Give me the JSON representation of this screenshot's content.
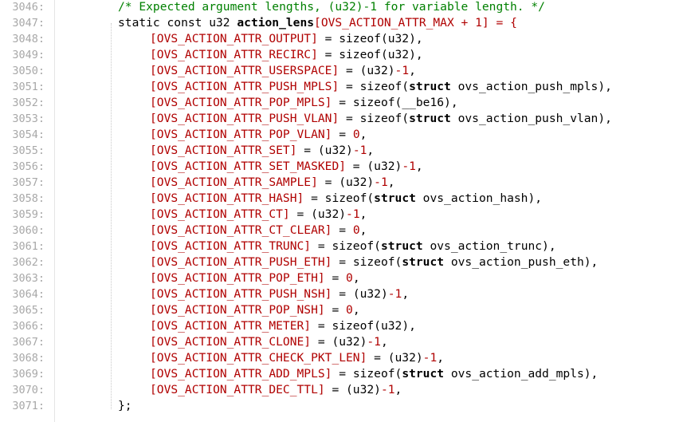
{
  "editor": {
    "comment": "/* Expected argument lengths, (u32)-1 for variable length. */",
    "decl": {
      "prefix": "static const u32 ",
      "name": "action_lens",
      "open": "[",
      "size_const": "OVS_ACTION_ATTR_MAX",
      "plus": " + ",
      "one": "1",
      "close": "] = {"
    },
    "closing": "};",
    "lines": [
      {
        "num": "3046:"
      },
      {
        "num": "3047:"
      },
      {
        "num": "3048:",
        "key": "OVS_ACTION_ATTR_OUTPUT",
        "value": "sizeof(u32),"
      },
      {
        "num": "3049:",
        "key": "OVS_ACTION_ATTR_RECIRC",
        "value": "sizeof(u32),"
      },
      {
        "num": "3050:",
        "key": "OVS_ACTION_ATTR_USERSPACE",
        "value": "(u32)-1,"
      },
      {
        "num": "3051:",
        "key": "OVS_ACTION_ATTR_PUSH_MPLS",
        "value_pre": "sizeof(",
        "value_kw": "struct",
        "value_post": " ovs_action_push_mpls),"
      },
      {
        "num": "3052:",
        "key": "OVS_ACTION_ATTR_POP_MPLS",
        "value": "sizeof(__be16),"
      },
      {
        "num": "3053:",
        "key": "OVS_ACTION_ATTR_PUSH_VLAN",
        "value_pre": "sizeof(",
        "value_kw": "struct",
        "value_post": " ovs_action_push_vlan),"
      },
      {
        "num": "3054:",
        "key": "OVS_ACTION_ATTR_POP_VLAN",
        "value": "0,"
      },
      {
        "num": "3055:",
        "key": "OVS_ACTION_ATTR_SET",
        "value": "(u32)-1,"
      },
      {
        "num": "3056:",
        "key": "OVS_ACTION_ATTR_SET_MASKED",
        "value": "(u32)-1,"
      },
      {
        "num": "3057:",
        "key": "OVS_ACTION_ATTR_SAMPLE",
        "value": "(u32)-1,"
      },
      {
        "num": "3058:",
        "key": "OVS_ACTION_ATTR_HASH",
        "value_pre": "sizeof(",
        "value_kw": "struct",
        "value_post": " ovs_action_hash),"
      },
      {
        "num": "3059:",
        "key": "OVS_ACTION_ATTR_CT",
        "value": "(u32)-1,"
      },
      {
        "num": "3060:",
        "key": "OVS_ACTION_ATTR_CT_CLEAR",
        "value": "0,"
      },
      {
        "num": "3061:",
        "key": "OVS_ACTION_ATTR_TRUNC",
        "value_pre": "sizeof(",
        "value_kw": "struct",
        "value_post": " ovs_action_trunc),"
      },
      {
        "num": "3062:",
        "key": "OVS_ACTION_ATTR_PUSH_ETH",
        "value_pre": "sizeof(",
        "value_kw": "struct",
        "value_post": " ovs_action_push_eth),"
      },
      {
        "num": "3063:",
        "key": "OVS_ACTION_ATTR_POP_ETH",
        "value": "0,"
      },
      {
        "num": "3064:",
        "key": "OVS_ACTION_ATTR_PUSH_NSH",
        "value": "(u32)-1,"
      },
      {
        "num": "3065:",
        "key": "OVS_ACTION_ATTR_POP_NSH",
        "value": "0,"
      },
      {
        "num": "3066:",
        "key": "OVS_ACTION_ATTR_METER",
        "value": "sizeof(u32),"
      },
      {
        "num": "3067:",
        "key": "OVS_ACTION_ATTR_CLONE",
        "value": "(u32)-1,"
      },
      {
        "num": "3068:",
        "key": "OVS_ACTION_ATTR_CHECK_PKT_LEN",
        "value": "(u32)-1,"
      },
      {
        "num": "3069:",
        "key": "OVS_ACTION_ATTR_ADD_MPLS",
        "value_pre": "sizeof(",
        "value_kw": "struct",
        "value_post": " ovs_action_add_mpls),"
      },
      {
        "num": "3070:",
        "key": "OVS_ACTION_ATTR_DEC_TTL",
        "value": "(u32)-1,"
      },
      {
        "num": "3071:"
      }
    ],
    "colors": {
      "comment": "#008000",
      "enum": "#b00000",
      "number": "#b00000",
      "gutter": "#a8a8a8"
    }
  }
}
